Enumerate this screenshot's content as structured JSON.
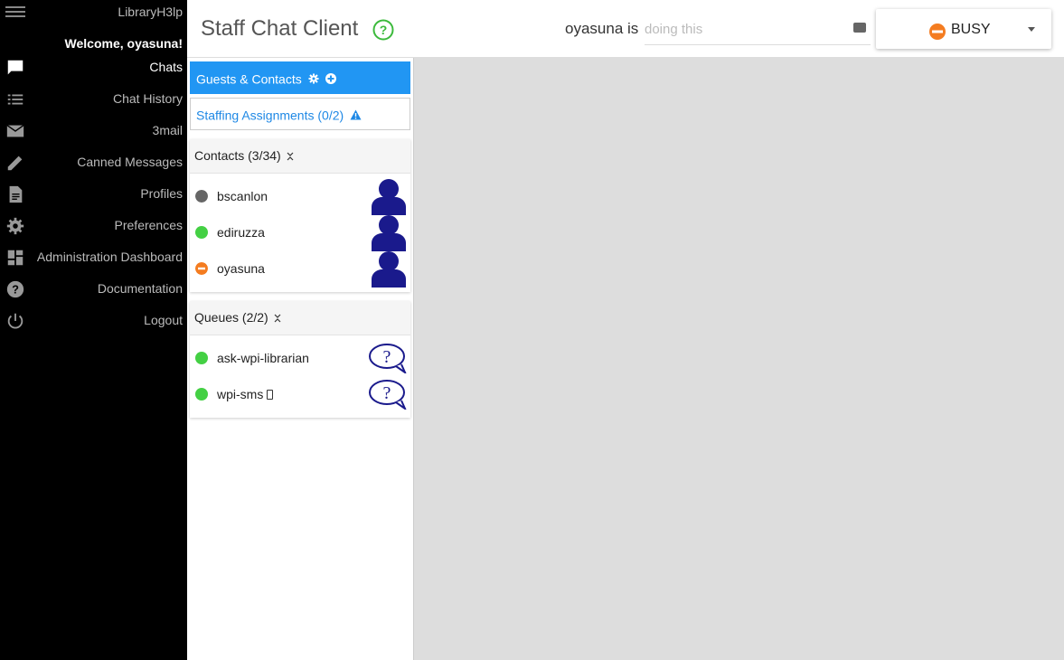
{
  "sidebar": {
    "brand": "LibraryH3lp",
    "welcome": "Welcome, oyasuna!",
    "items": [
      {
        "label": "Chats",
        "icon": "chat-bubble-icon",
        "active": true
      },
      {
        "label": "Chat History",
        "icon": "list-icon"
      },
      {
        "label": "3mail",
        "icon": "mail-icon"
      },
      {
        "label": "Canned Messages",
        "icon": "pencil-icon"
      },
      {
        "label": "Profiles",
        "icon": "document-icon"
      },
      {
        "label": "Preferences",
        "icon": "gear-icon"
      },
      {
        "label": "Administration Dashboard",
        "icon": "dashboard-icon"
      },
      {
        "label": "Documentation",
        "icon": "help-icon"
      },
      {
        "label": "Logout",
        "icon": "power-icon"
      }
    ]
  },
  "header": {
    "title": "Staff Chat Client",
    "status_prefix": "oyasuna is",
    "status_placeholder": "doing this",
    "presence": "BUSY",
    "colors": {
      "help": "#3cba3c",
      "busy": "#f47c20"
    }
  },
  "panel": {
    "tabs": {
      "guests": "Guests & Contacts",
      "staffing": "Staffing Assignments (0/2)"
    },
    "contacts": {
      "header": "Contacts (3/34)",
      "items": [
        {
          "name": "bscanlon",
          "status": "away"
        },
        {
          "name": "ediruzza",
          "status": "available"
        },
        {
          "name": "oyasuna",
          "status": "busy"
        }
      ]
    },
    "queues": {
      "header": "Queues (2/2)",
      "items": [
        {
          "name": "ask-wpi-librarian",
          "status": "available"
        },
        {
          "name": "wpi-sms",
          "status": "available",
          "icon": "mobile-phone-icon"
        }
      ]
    }
  }
}
